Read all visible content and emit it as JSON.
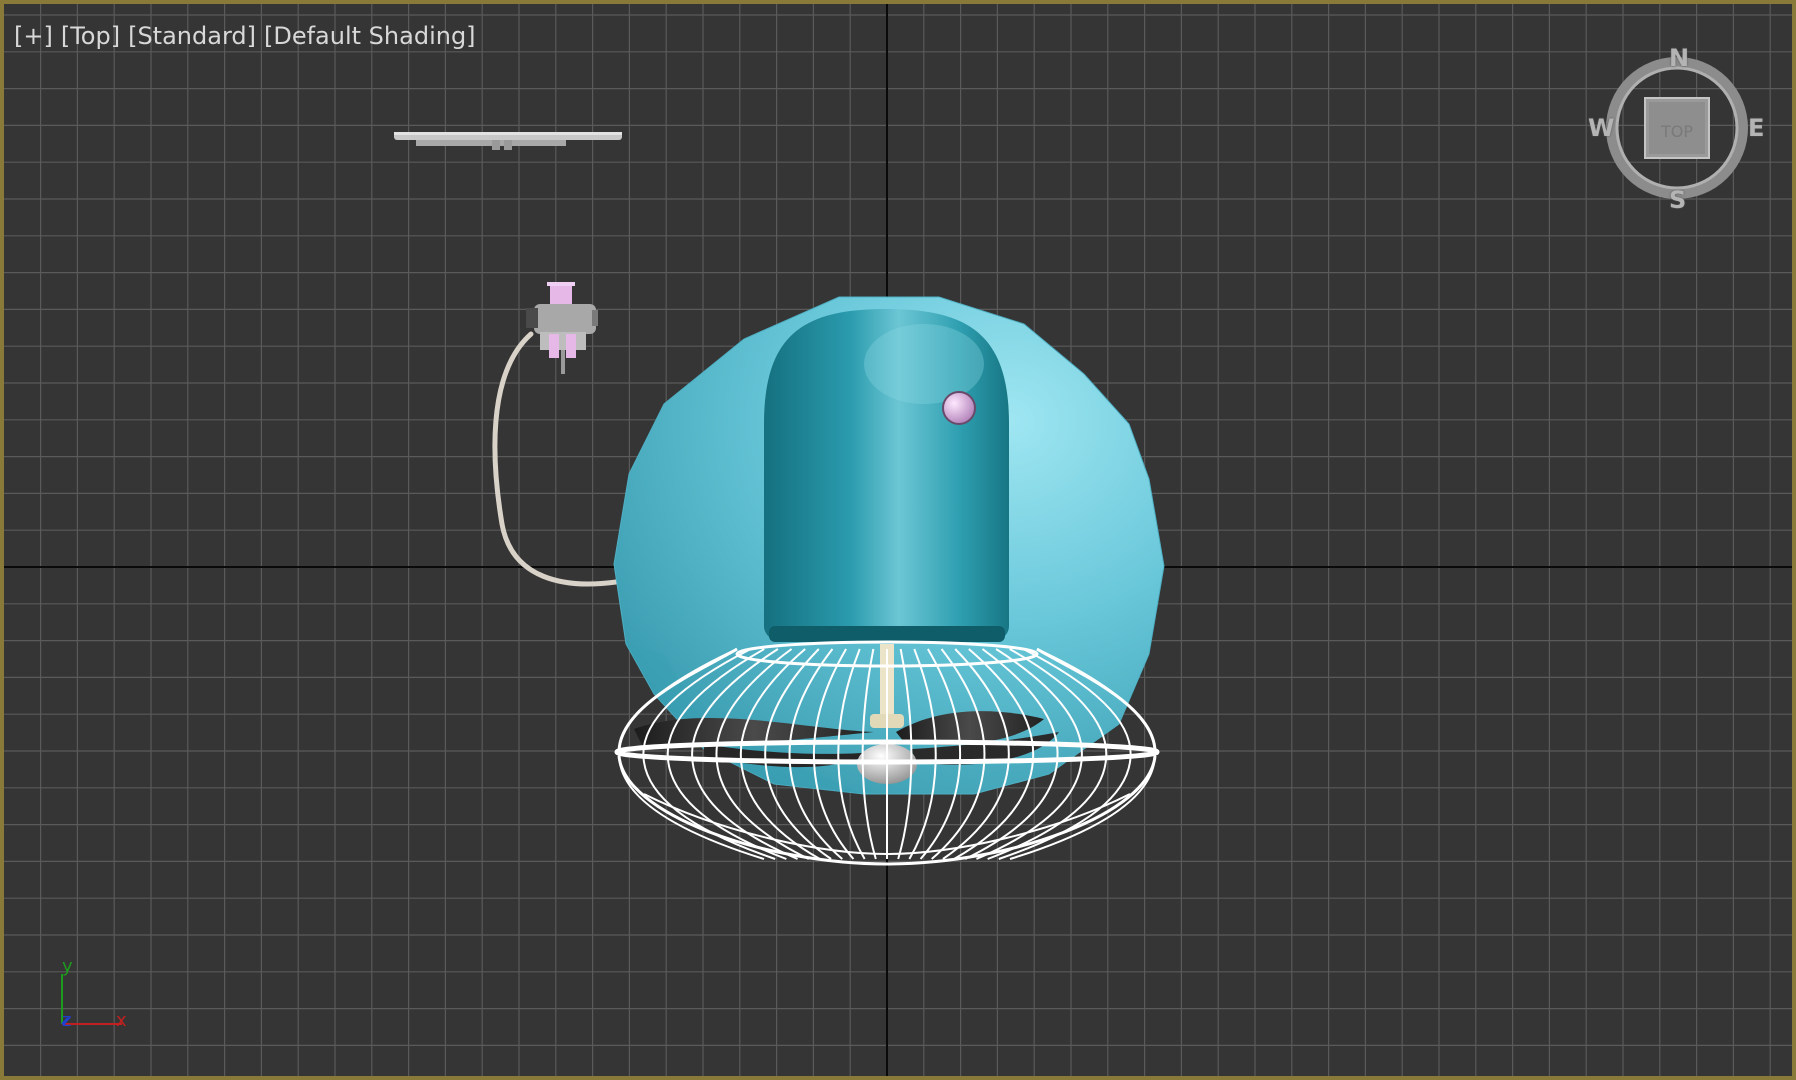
{
  "viewport": {
    "labels": [
      "[+]",
      "[Top]",
      "[Standard]",
      "[Default Shading]"
    ]
  },
  "viewcube": {
    "face": "TOP",
    "north": "N",
    "south": "S",
    "east": "E",
    "west": "W"
  },
  "axis_tripod": {
    "x": "x",
    "y": "y",
    "z": "z"
  },
  "colors": {
    "viewport_border": "#8a7a3a",
    "background": "#353535",
    "grid": "#5a5a5a",
    "grid_axis": "#0a0a0a",
    "fan_body": "#5fc0d2",
    "motor": "#2a98aa",
    "cage": "#ffffff",
    "plug_accent": "#e6b8e8"
  }
}
